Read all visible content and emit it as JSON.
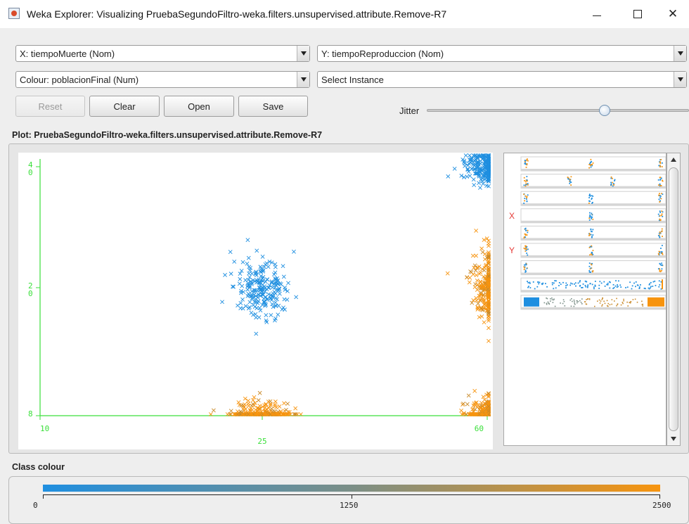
{
  "window": {
    "title": "Weka Explorer: Visualizing PruebaSegundoFiltro-weka.filters.unsupervised.attribute.Remove-R7",
    "minimize_glyph": "—",
    "maximize_glyph": "☐",
    "close_glyph": "✕"
  },
  "controls": {
    "x_axis": "X: tiempoMuerte (Nom)",
    "y_axis": "Y: tiempoReproduccion (Nom)",
    "colour": "Colour: poblacionFinal (Num)",
    "select_instance": "Select Instance",
    "buttons": {
      "reset": "Reset",
      "clear": "Clear",
      "open": "Open",
      "save": "Save"
    },
    "reset_enabled": false,
    "jitter_label": "Jitter",
    "jitter_fraction": 0.66
  },
  "plot": {
    "label": "Plot: PruebaSegundoFiltro-weka.filters.unsupervised.attribute.Remove-R7",
    "axis_color": "#3adf3a",
    "y_ticks": [
      {
        "line1": "4",
        "line2": "0"
      },
      {
        "line1": "2",
        "line2": "0"
      },
      {
        "line1": "8",
        "line2": ""
      }
    ],
    "x_ticks": [
      "10",
      "25",
      "60"
    ]
  },
  "chart_data": {
    "type": "scatter",
    "x_categories": [
      "10",
      "25",
      "60"
    ],
    "y_categories": [
      "8",
      "20",
      "40"
    ],
    "colour_attribute": "poblacionFinal",
    "colour_range": [
      0,
      2500
    ],
    "clusters": [
      {
        "x": "60",
        "y": "40",
        "colour": "#1f8fe0",
        "points": 260
      },
      {
        "x": "25",
        "y": "20",
        "colour": "#1f8fe0",
        "points": 220
      },
      {
        "x": "60",
        "y": "20",
        "colour": "#f7940f",
        "points": 240
      },
      {
        "x": "25",
        "y": "8",
        "colour": "#f7940f",
        "points": 260
      },
      {
        "x": "60",
        "y": "8",
        "colour": "#f7940f",
        "points": 280
      }
    ]
  },
  "matrix": {
    "x_marker": "X",
    "y_marker": "Y",
    "marker_color": "#e53935",
    "rows": 9
  },
  "legend": {
    "label": "Class colour",
    "min": "0",
    "mid": "1250",
    "max": "2500",
    "low_color": "#1f8fe0",
    "high_color": "#f7940f"
  }
}
